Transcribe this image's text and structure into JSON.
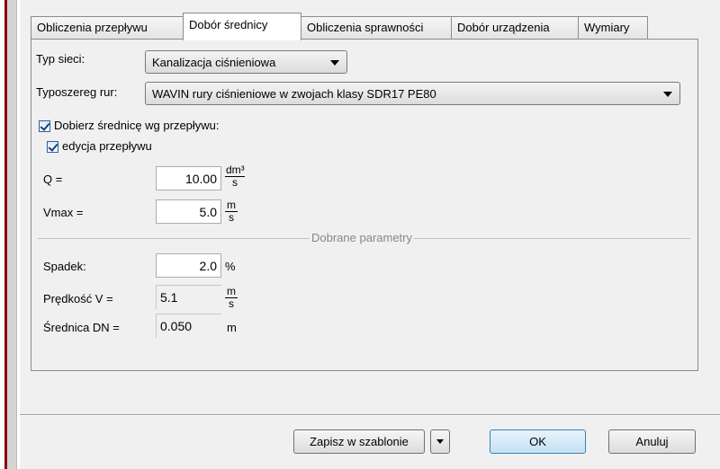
{
  "tabs": [
    {
      "label": "Obliczenia przepływu"
    },
    {
      "label": "Dobór średnicy"
    },
    {
      "label": "Obliczenia sprawności"
    },
    {
      "label": "Dobór urządzenia"
    },
    {
      "label": "Wymiary"
    }
  ],
  "network_type": {
    "label": "Typ sieci:",
    "value": "Kanalizacja ciśnieniowa"
  },
  "pipe_series": {
    "label": "Typoszereg rur:",
    "value": "WAVIN rury ciśnieniowe w zwojach klasy SDR17 PE80"
  },
  "options": {
    "select_by_flow": {
      "label": "Dobierz średnicę wg przepływu:",
      "checked": true
    },
    "edit_flow": {
      "label": "edycja przepływu",
      "checked": true
    }
  },
  "inputs": {
    "q": {
      "label": "Q =",
      "value": "10.00",
      "unit_num": "dm³",
      "unit_den": "s"
    },
    "vmax": {
      "label": "Vmax =",
      "value": "5.0",
      "unit_num": "m",
      "unit_den": "s"
    }
  },
  "results": {
    "section_title": "Dobrane parametry",
    "slope": {
      "label": "Spadek:",
      "value": "2.0",
      "unit": "%"
    },
    "velocity": {
      "label": "Prędkość V =",
      "value": "5.1",
      "unit_num": "m",
      "unit_den": "s"
    },
    "diameter": {
      "label": "Średnica DN =",
      "value": "0.050",
      "unit": "m"
    }
  },
  "buttons": {
    "save_template": "Zapisz w szablonie",
    "ok": "OK",
    "cancel": "Anuluj"
  }
}
